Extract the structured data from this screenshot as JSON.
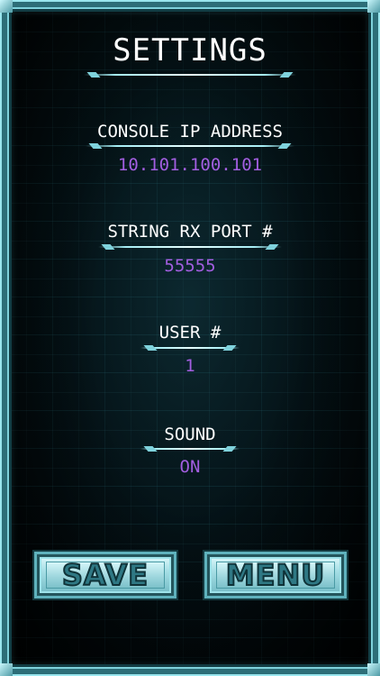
{
  "title": "SETTINGS",
  "fields": [
    {
      "label": "CONSOLE IP ADDRESS",
      "value": "10.101.100.101"
    },
    {
      "label": "STRING RX PORT #",
      "value": "55555"
    },
    {
      "label": "USER #",
      "value": "1"
    },
    {
      "label": "SOUND",
      "value": "ON"
    }
  ],
  "buttons": {
    "save_label": "SAVE",
    "menu_label": "MENU"
  },
  "colors": {
    "value": "#a25ee0",
    "label": "#ffffff",
    "frame": "#2d6e78",
    "button": "#a6dfe6"
  }
}
